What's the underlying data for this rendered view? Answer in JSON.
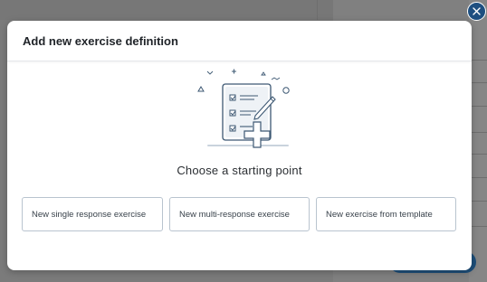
{
  "modal": {
    "title": "Add new exercise definition",
    "subtitle": "Choose a starting point",
    "close_icon": "close-icon",
    "illustration_icon": "checklist-plus-icon",
    "options": [
      {
        "label": "New single response exercise"
      },
      {
        "label": "New multi-response exercise"
      },
      {
        "label": "New exercise from template"
      }
    ]
  },
  "colors": {
    "accent": "#1e4f80",
    "illustration_stroke": "#3d5873",
    "illustration_fill": "#eef2f6",
    "option_border": "#b9c4cf"
  }
}
